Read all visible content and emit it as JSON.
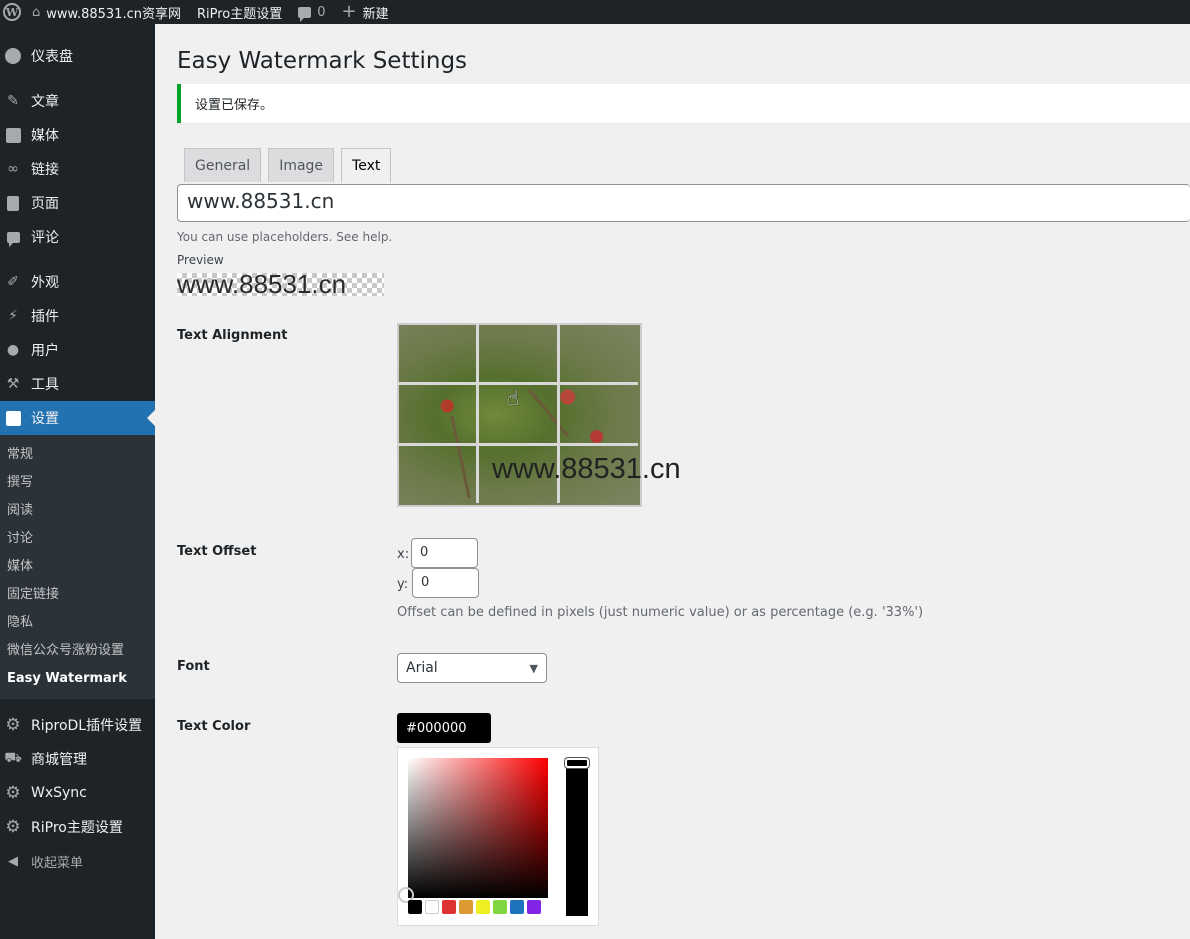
{
  "adminbar": {
    "site_name": "www.88531.cn资享网",
    "theme_settings": "RiPro主题设置",
    "comments_count": "0",
    "new_label": "新建"
  },
  "menu": {
    "items": [
      {
        "label": "仪表盘",
        "icon": "dashboard-icon"
      },
      {
        "label": "文章",
        "icon": "pin-icon"
      },
      {
        "label": "媒体",
        "icon": "media-icon"
      },
      {
        "label": "链接",
        "icon": "link-icon"
      },
      {
        "label": "页面",
        "icon": "page-icon"
      },
      {
        "label": "评论",
        "icon": "comment-icon"
      },
      {
        "label": "外观",
        "icon": "brush-icon"
      },
      {
        "label": "插件",
        "icon": "plugin-icon"
      },
      {
        "label": "用户",
        "icon": "user-icon"
      },
      {
        "label": "工具",
        "icon": "wrench-icon"
      },
      {
        "label": "设置",
        "icon": "settings-icon"
      }
    ],
    "submenu": [
      "常规",
      "撰写",
      "阅读",
      "讨论",
      "媒体",
      "固定链接",
      "隐私",
      "微信公众号涨粉设置",
      "Easy Watermark"
    ],
    "after": [
      {
        "label": "RiproDL插件设置",
        "icon": "gear-icon"
      },
      {
        "label": "商城管理",
        "icon": "cart-icon"
      },
      {
        "label": "WxSync",
        "icon": "gear-icon"
      },
      {
        "label": "RiPro主题设置",
        "icon": "gear-icon"
      }
    ],
    "collapse": "收起菜单"
  },
  "page": {
    "title": "Easy Watermark Settings",
    "notice": "设置已保存。",
    "tabs": [
      "General",
      "Image",
      "Text"
    ],
    "active_tab": "Text",
    "text_value": "www.88531.cn",
    "placeholder_help": "You can use placeholders. See help.",
    "preview_label": "Preview",
    "preview_text": "www.88531.cn",
    "alignment_label": "Text Alignment",
    "alignment_overlay_text": "www.88531.cn",
    "offset_label": "Text Offset",
    "offset_x_label": "x:",
    "offset_x": "0",
    "offset_y_label": "y:",
    "offset_y": "0",
    "offset_help": "Offset can be defined in pixels (just numeric value) or as percentage (e.g. '33%')",
    "font_label": "Font",
    "font_value": "Arial",
    "color_label": "Text Color",
    "color_value": "#000000",
    "swatch_colors": [
      "#000000",
      "#ffffff",
      "#dd3333",
      "#dd9933",
      "#eeee22",
      "#81d742",
      "#1e73be",
      "#8224e3"
    ]
  }
}
